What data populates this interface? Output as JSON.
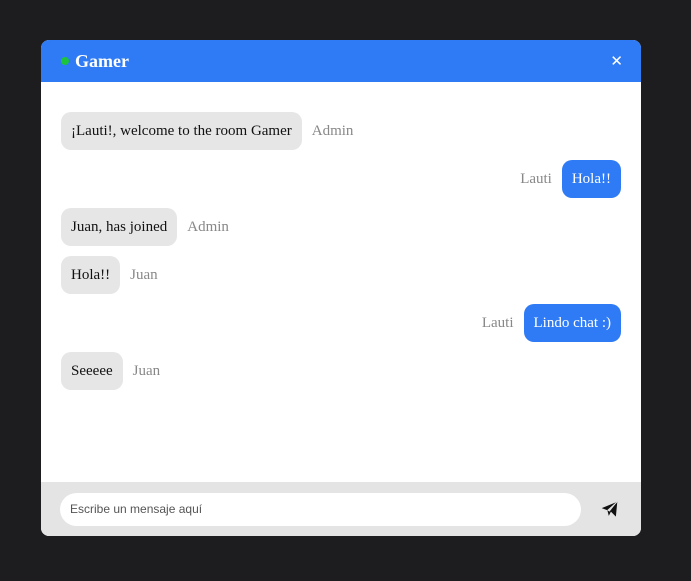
{
  "header": {
    "room_name": "Gamer",
    "close_icon": "close-icon",
    "status_color": "#1ec33c",
    "accent_color": "#2f7bf5"
  },
  "messages": [
    {
      "direction": "incoming",
      "text": "¡Lauti!, welcome to the room Gamer",
      "sender": "Admin"
    },
    {
      "direction": "outgoing",
      "text": "Hola!!",
      "sender": "Lauti"
    },
    {
      "direction": "incoming",
      "text": "Juan, has joined",
      "sender": "Admin"
    },
    {
      "direction": "incoming",
      "text": "Hola!!",
      "sender": "Juan"
    },
    {
      "direction": "outgoing",
      "text": "Lindo chat :)",
      "sender": "Lauti"
    },
    {
      "direction": "incoming",
      "text": "Seeeee",
      "sender": "Juan"
    }
  ],
  "composer": {
    "placeholder": "Escribe un mensaje aquí",
    "value": "",
    "send_icon": "send-icon"
  }
}
